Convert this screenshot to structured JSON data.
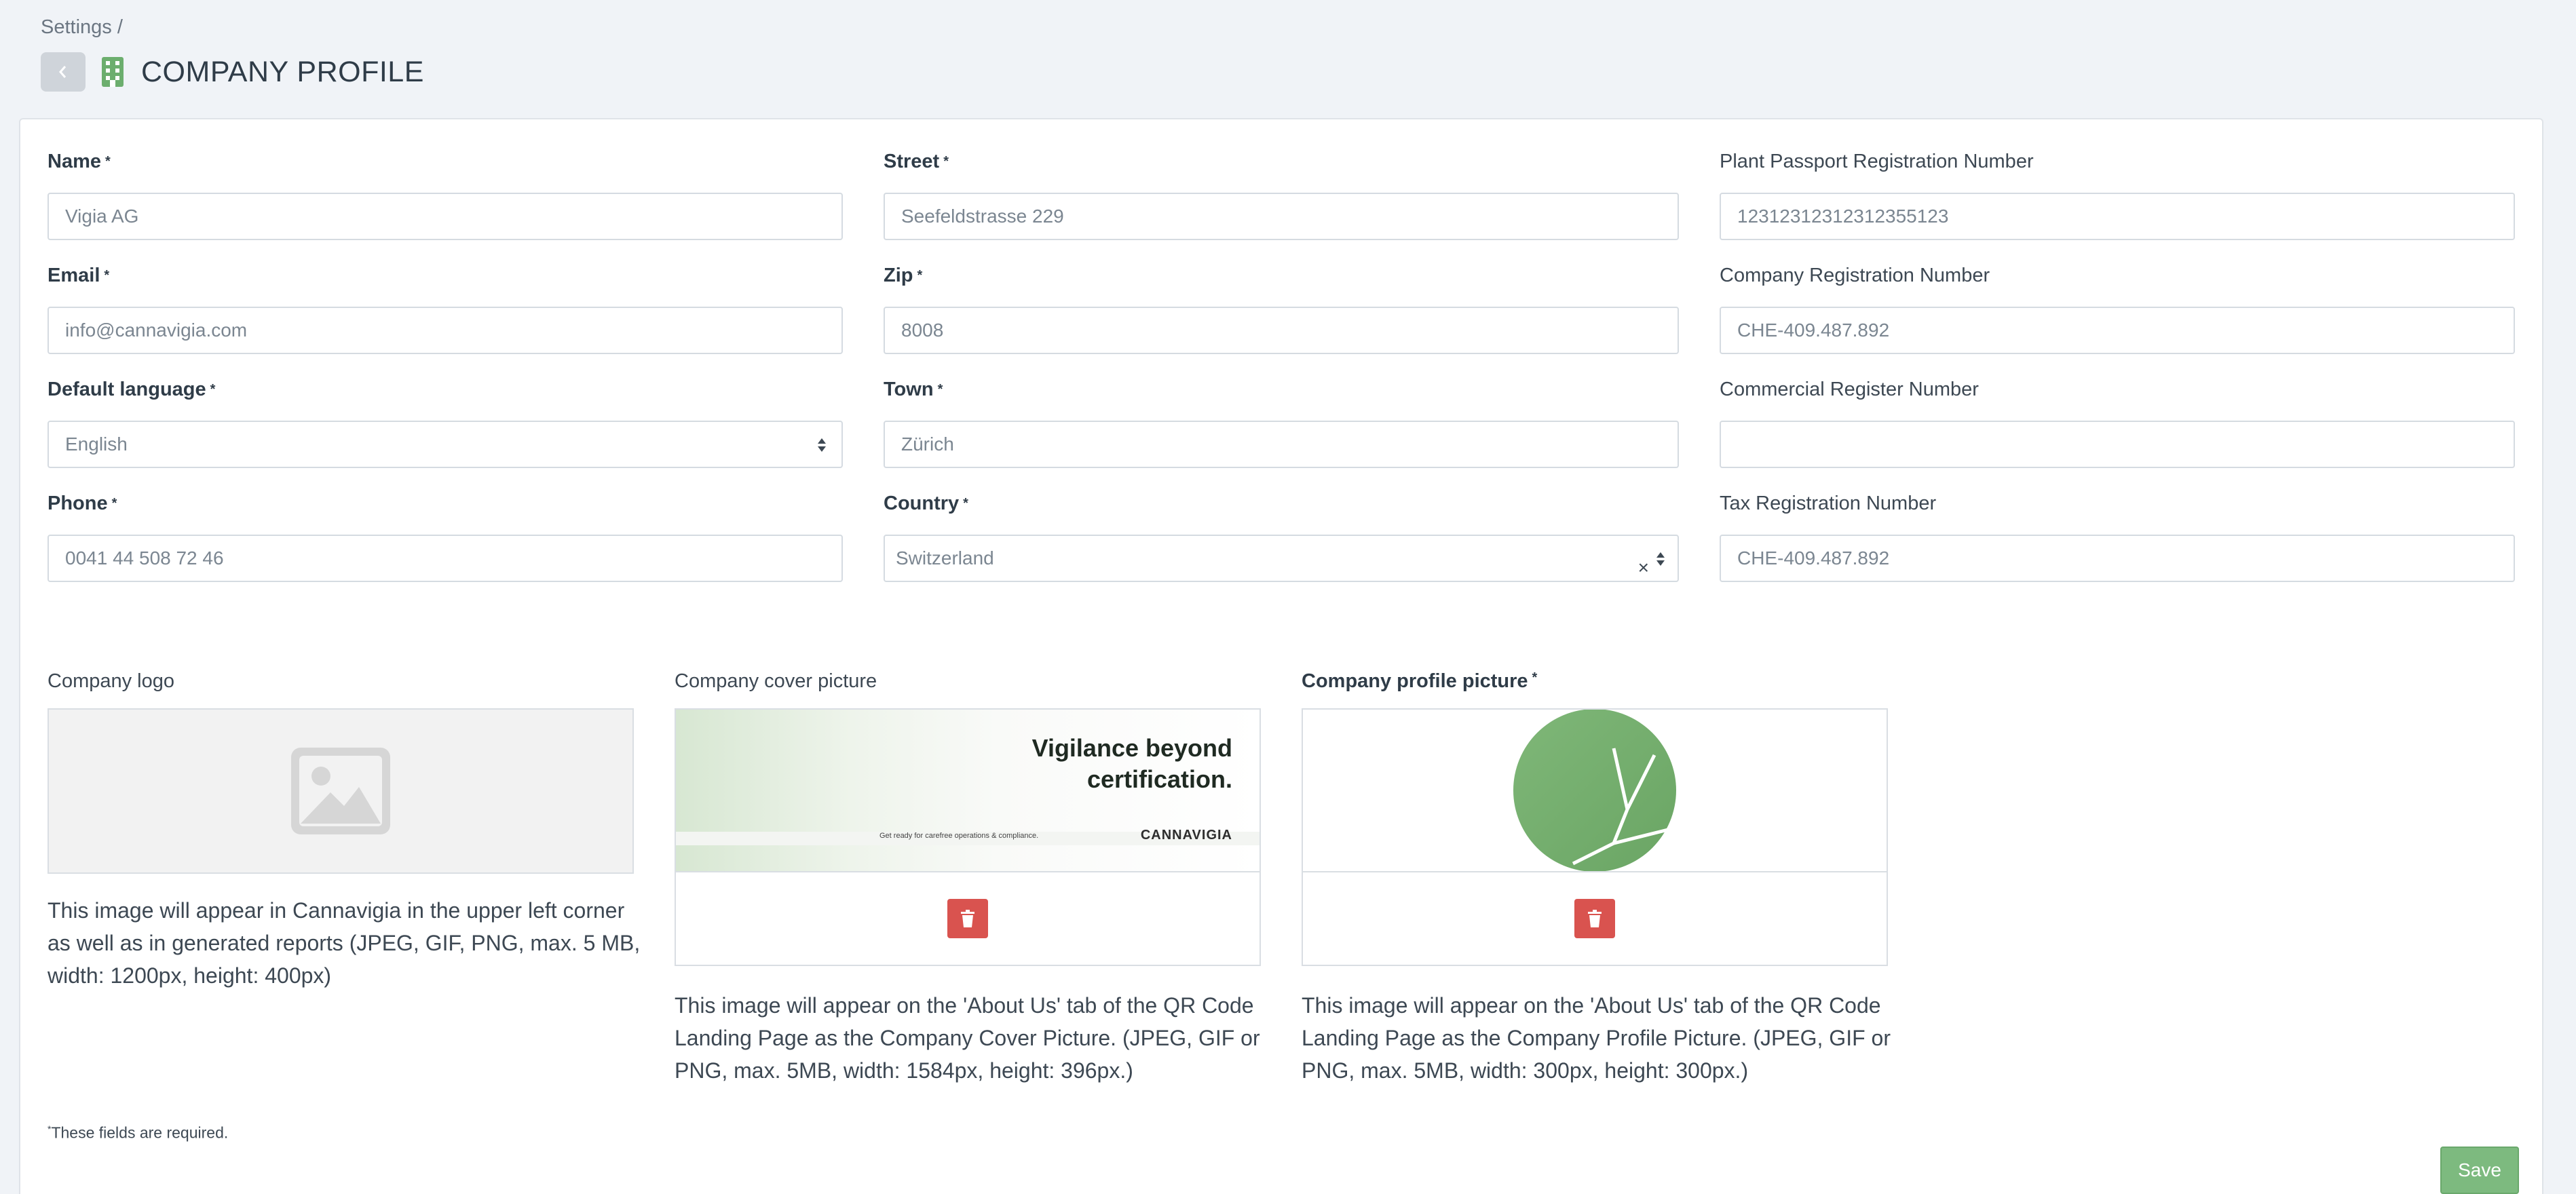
{
  "breadcrumb": {
    "text": "Settings /"
  },
  "header": {
    "title": "COMPANY PROFILE",
    "back_icon": "chevron-left-icon",
    "title_icon": "building-icon",
    "accent": "#6cae6e"
  },
  "form": {
    "required_marker": "*",
    "name": {
      "label": "Name",
      "value": "Vigia AG"
    },
    "email": {
      "label": "Email",
      "value": "info@cannavigia.com"
    },
    "language": {
      "label": "Default language",
      "value": "English"
    },
    "phone": {
      "label": "Phone",
      "value": "0041 44 508 72 46"
    },
    "street": {
      "label": "Street",
      "value": "Seefeldstrasse 229"
    },
    "zip": {
      "label": "Zip",
      "value": "8008"
    },
    "town": {
      "label": "Town",
      "value": "Zürich"
    },
    "country": {
      "label": "Country",
      "value": "Switzerland",
      "clear": "×"
    },
    "plant_passport": {
      "label": "Plant Passport Registration Number",
      "value": "12312312312312355123"
    },
    "company_reg": {
      "label": "Company Registration Number",
      "value": "CHE-409.487.892"
    },
    "commercial_reg": {
      "label": "Commercial Register Number",
      "value": ""
    },
    "tax_reg": {
      "label": "Tax Registration Number",
      "value": "CHE-409.487.892"
    }
  },
  "uploads": {
    "logo": {
      "label": "Company logo",
      "help": "This image will appear in Cannavigia in the upper left corner as well as in generated reports (JPEG, GIF, PNG, max. 5 MB, width: 1200px, height: 400px)"
    },
    "cover": {
      "label": "Company cover picture",
      "image_heading_1": "Vigilance beyond",
      "image_heading_2": "certification.",
      "image_small": "Get ready for carefree operations & compliance.",
      "image_brand": "CANNAVIGIA",
      "help": "This image will appear on the 'About Us' tab of the QR Code Landing Page as the Company Cover Picture. (JPEG, GIF or PNG, max. 5MB, width: 1584px, height: 396px.)"
    },
    "profile": {
      "label": "Company profile picture",
      "help": "This image will appear on the 'About Us' tab of the QR Code Landing Page as the Company Profile Picture. (JPEG, GIF or PNG, max. 5MB, width: 300px, height: 300px.)"
    }
  },
  "footer": {
    "required_note": "These fields are required.",
    "save_label": "Save"
  }
}
